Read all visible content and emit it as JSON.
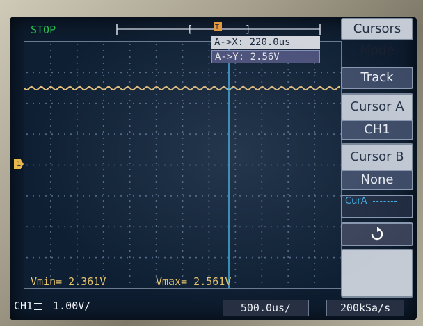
{
  "status": "STOP",
  "trigger": {
    "marker": "T"
  },
  "cursor_readout": {
    "x_label": "A->X:",
    "x_value": "220.0us",
    "y_label": "A->Y:",
    "y_value": "2.56V"
  },
  "menu": {
    "title": "Cursors",
    "mode_label": "Mode",
    "mode_value": "Track",
    "cursor_a_label": "Cursor A",
    "cursor_a_value": "CH1",
    "cursor_b_label": "Cursor B",
    "cursor_b_value": "None",
    "cur_label": "CurA",
    "rotate_icon": "rotate-icon"
  },
  "measurements": {
    "vmin": "Vmin= 2.361V",
    "vmax": "Vmax= 2.561V"
  },
  "bottom_bar": {
    "channel": "CH1",
    "coupling_icon": "dc-coupling-icon",
    "volts_div": "1.00V/",
    "time_div": "500.0us/",
    "sample_rate": "200kSa/s"
  },
  "channel_marker": "1",
  "colors": {
    "ch1": "#e6c07a",
    "cursor": "#3fb3e6",
    "status": "#28c050"
  }
}
